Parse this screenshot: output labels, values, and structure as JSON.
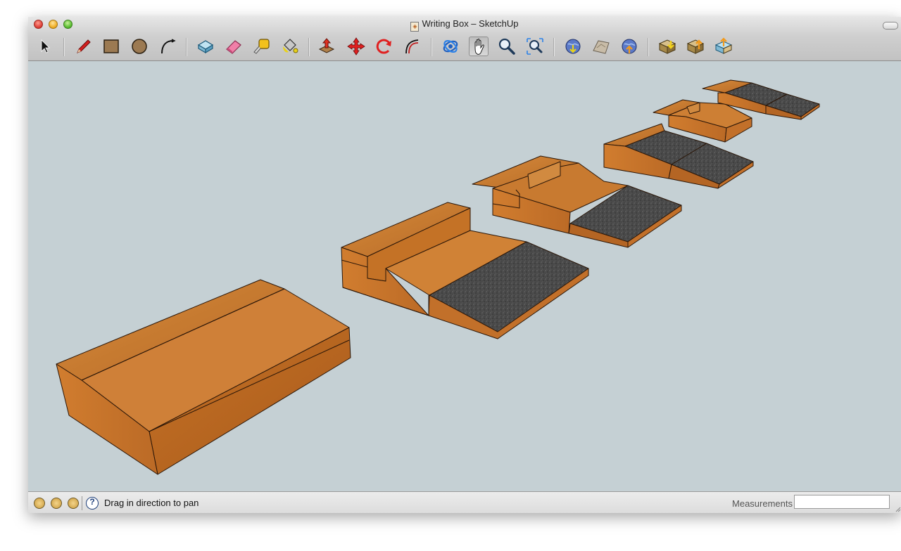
{
  "window": {
    "title": "Writing Box – SketchUp"
  },
  "toolbar": {
    "tools": [
      {
        "name": "select-tool",
        "icon": "arrow-cursor-icon"
      },
      {
        "name": "line-tool",
        "icon": "pencil-icon"
      },
      {
        "name": "rectangle-tool",
        "icon": "rectangle-icon"
      },
      {
        "name": "circle-tool",
        "icon": "circle-icon"
      },
      {
        "name": "arc-tool",
        "icon": "arc-icon"
      },
      {
        "name": "make-component-tool",
        "icon": "component-box-icon"
      },
      {
        "name": "eraser-tool",
        "icon": "eraser-icon"
      },
      {
        "name": "tape-measure-tool",
        "icon": "tape-measure-icon"
      },
      {
        "name": "paint-bucket-tool",
        "icon": "paint-bucket-icon"
      },
      {
        "name": "push-pull-tool",
        "icon": "push-pull-icon"
      },
      {
        "name": "move-tool",
        "icon": "move-arrows-icon"
      },
      {
        "name": "rotate-tool",
        "icon": "rotate-icon"
      },
      {
        "name": "offset-tool",
        "icon": "offset-icon"
      },
      {
        "name": "orbit-tool",
        "icon": "orbit-icon"
      },
      {
        "name": "pan-tool",
        "icon": "hand-icon"
      },
      {
        "name": "zoom-tool",
        "icon": "magnifier-icon"
      },
      {
        "name": "zoom-extents-tool",
        "icon": "zoom-extents-icon"
      },
      {
        "name": "get-current-view-tool",
        "icon": "earth-download-icon"
      },
      {
        "name": "toggle-terrain-tool",
        "icon": "terrain-icon"
      },
      {
        "name": "place-model-tool",
        "icon": "earth-upload-icon"
      },
      {
        "name": "get-models-tool",
        "icon": "warehouse-get-icon"
      },
      {
        "name": "share-model-tool",
        "icon": "warehouse-share-icon"
      },
      {
        "name": "share-component-tool",
        "icon": "share-component-icon"
      }
    ],
    "active_tool": "pan-tool"
  },
  "statusbar": {
    "hint": "Drag in direction to pan",
    "measurements_label": "Measurements",
    "measurements_value": ""
  },
  "colors": {
    "viewport_background": "#c5d0d4",
    "wood": "#c8772e",
    "stone": "#4a4a4a"
  }
}
